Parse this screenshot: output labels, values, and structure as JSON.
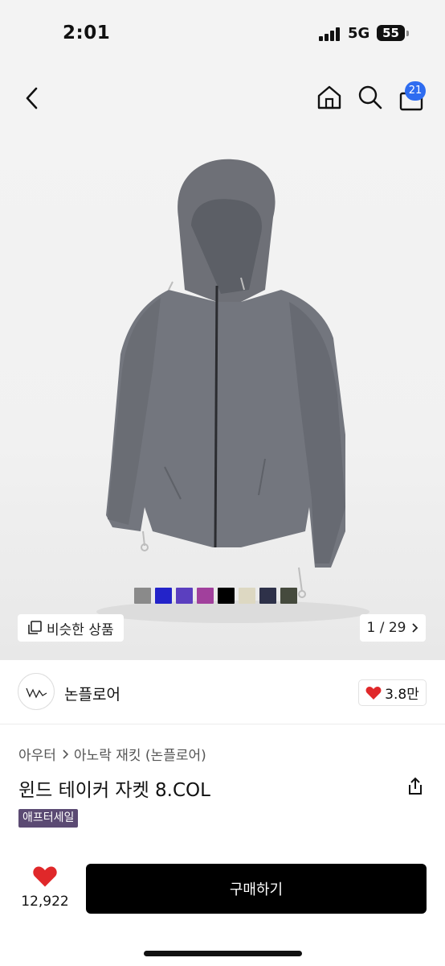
{
  "status_bar": {
    "time": "2:01",
    "network": "5G",
    "battery": "55"
  },
  "nav": {
    "back_icon": "chevron-left-icon",
    "home_icon": "home-icon",
    "search_icon": "search-icon",
    "cart_icon": "shopping-bag-icon",
    "cart_count": "21"
  },
  "gallery": {
    "swatch_colors": [
      "#8a8a8a",
      "#2323c9",
      "#5b3fbf",
      "#a1409c",
      "#000000",
      "#ddd8c2",
      "#2e3149",
      "#454a3d"
    ],
    "similar_label": "비슷한 상품",
    "similar_icon": "copy-icon",
    "page_indicator": "1 / 29"
  },
  "shop": {
    "name": "논플로어",
    "like_count": "3.8만"
  },
  "product": {
    "breadcrumb": [
      "아우터",
      "아노락 재킷 (논플로어)"
    ],
    "title": "윈드 테이커 자켓 8.COL",
    "badge": "애프터세일"
  },
  "bottom": {
    "wish_count": "12,922",
    "buy_label": "구매하기"
  },
  "colors": {
    "accent_badge": "#2e6cf0",
    "heart": "#e0282a",
    "sale_badge": "#5b4a73",
    "buy_button": "#000000"
  }
}
